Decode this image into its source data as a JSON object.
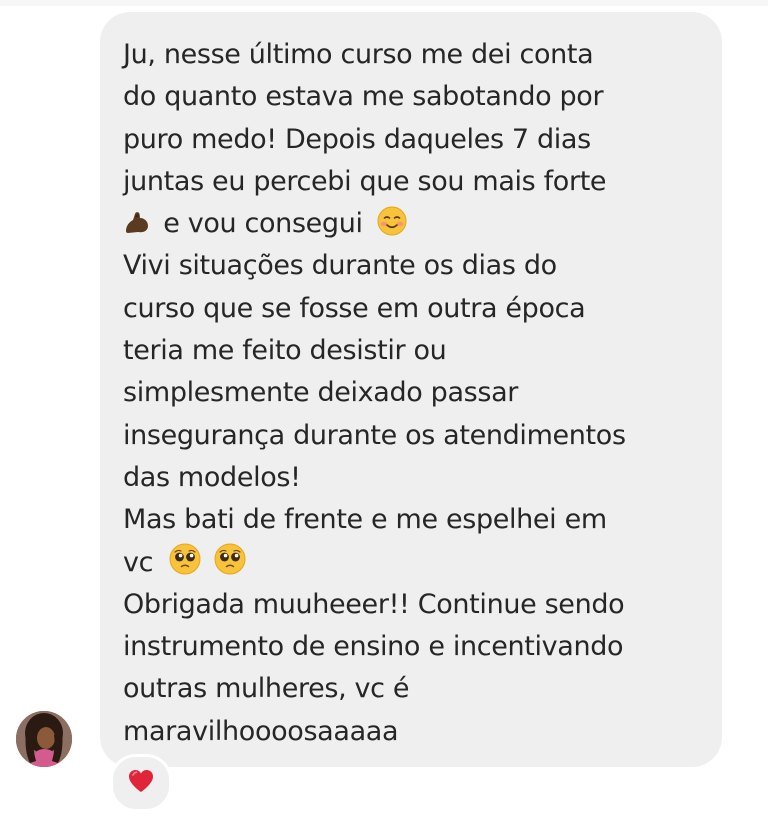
{
  "message": {
    "lines": [
      "Ju, nesse último curso me dei conta",
      "do quanto estava me sabotando por",
      "puro medo! Depois daqueles 7 dias",
      "juntas eu percebi que sou mais forte",
      "e vou consegui",
      "Vivi situações durante os dias do",
      "curso que se fosse em outra época",
      "teria me feito desistir ou",
      "simplesmente deixado passar",
      "insegurança durante os atendimentos",
      "das modelos!",
      "Mas bati de frente e me espelhei em",
      "vc",
      "Obrigada muuheeer!! Continue sendo",
      "instrumento de ensino e incentivando",
      "outras mulheres, vc é",
      "maravilhoooosaaaaa"
    ],
    "emojis": {
      "line5_lead": "flexed-biceps-icon",
      "line5_trail": "smiling-face-icon",
      "line13_trail": [
        "pleading-face-icon",
        "pleading-face-icon"
      ]
    }
  },
  "sender": {
    "avatar": "avatar-photo"
  },
  "reaction": {
    "icon": "red-heart-icon"
  },
  "colors": {
    "bubble": "#efefef",
    "text": "#262626",
    "heart": "#e0243a"
  }
}
